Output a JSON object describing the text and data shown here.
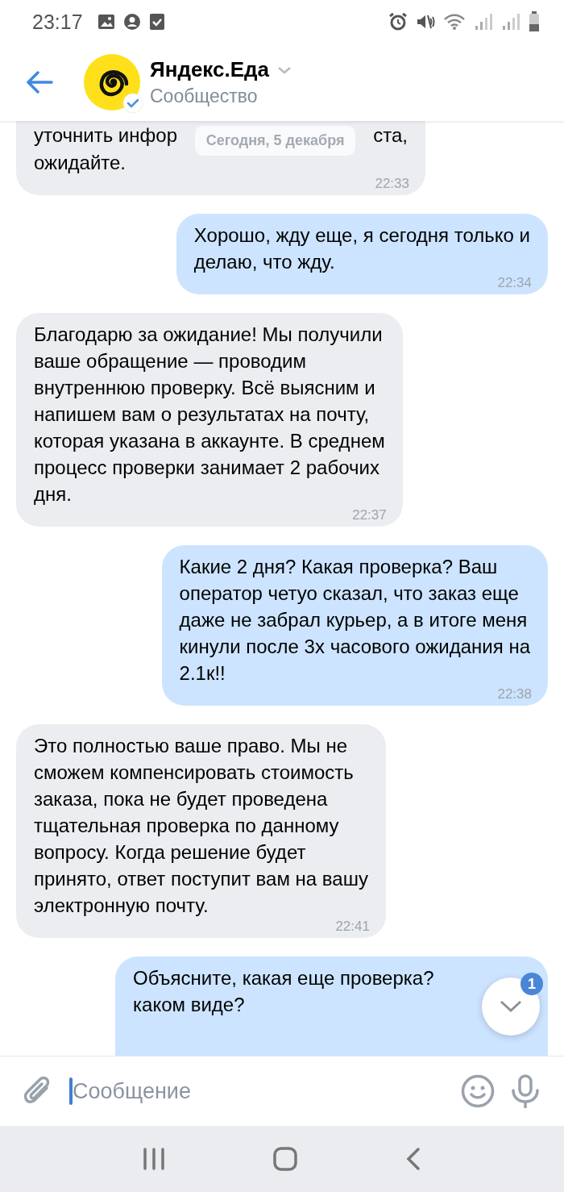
{
  "status_bar": {
    "time": "23:17"
  },
  "header": {
    "title": "Яндекс.Еда",
    "subtitle": "Сообщество",
    "verified": true
  },
  "date_chip": "Сегодня, 5 декабря",
  "messages": [
    {
      "outgoing": false,
      "kind": "partial",
      "fragments": [
        "уточнить инфор",
        "ста,"
      ],
      "text": "ожидайте.",
      "time": "22:33"
    },
    {
      "outgoing": true,
      "kind": "full",
      "text": "Хорошо, жду еще, я сегодня только и\nделаю, что жду.",
      "time": "22:34"
    },
    {
      "outgoing": false,
      "kind": "full",
      "text": "Благодарю за ожидание! Мы получили\nваше обращение — проводим\nвнутреннюю проверку. Всё выясним и\nнапишем вам о результатах на почту,\nкоторая указана в аккаунте. В среднем\nпроцесс проверки занимает 2 рабочих\nдня.",
      "time": "22:37"
    },
    {
      "outgoing": true,
      "kind": "full",
      "text": "Какие 2 дня? Какая проверка? Ваш\nоператор четуо сказал, что заказ еще\nдаже не забрал курьер, а в итоге меня\nкинули после 3х часового ожидания на\n2.1к!!",
      "time": "22:38"
    },
    {
      "outgoing": false,
      "kind": "full",
      "text": "Это полностью ваше право. Мы не\nсможем компенсировать стоимость\nзаказа, пока не будет проведена\nтщательная проверка по данному\nвопросу. Когда решение будет\nпринято, ответ поступит вам на вашу\nэлектронную почту.",
      "time": "22:41"
    },
    {
      "outgoing": true,
      "kind": "full",
      "text": "Объясните, какая еще проверка?\nкаком виде?"
    }
  ],
  "scroll_button": {
    "badge": "1"
  },
  "composer": {
    "placeholder": "Сообщение"
  }
}
